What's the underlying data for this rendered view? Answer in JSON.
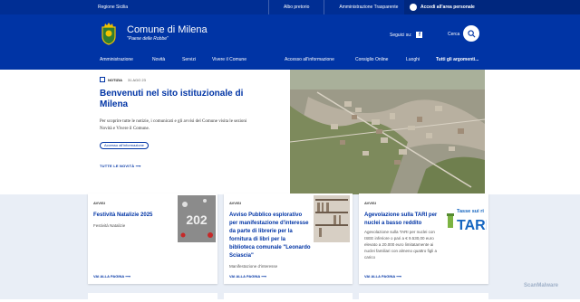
{
  "topbar": {
    "region": "Regione Sicilia",
    "links": [
      "Albo pretorio",
      "Amministrazione Trasparente"
    ],
    "login": "Accedi all'area personale"
  },
  "header": {
    "name": "Comune di Milena",
    "motto": "\"Paese delle Robbe\"",
    "social_label": "Seguici su:",
    "search_label": "Cerca"
  },
  "nav": {
    "left": [
      "Amministrazione",
      "Novità",
      "Servizi",
      "Vivere il Comune"
    ],
    "right": [
      "Accesso all'informazione",
      "Consiglio Online",
      "Luoghi",
      "Tutti gli argomenti..."
    ]
  },
  "hero": {
    "tag": "NOTIZIA",
    "date": "31 AGO 23",
    "title": "Benvenuti nel sito istituzionale di Milena",
    "text": "Per scoprire tutte le notizie, i comunicati e gli avvisi del Comune visita le sezioni Novità e Vivere il Comune.",
    "pill": "Accesso all'informazione",
    "all_news": "TUTTE LE NOVITÀ"
  },
  "cards": [
    {
      "kind": "AVVISI",
      "title": "Festività Natalizie 2025",
      "sub": "Festività Natalizie",
      "more": "VAI ALLA PAGINA",
      "thumb_text": "202"
    },
    {
      "kind": "AVVISI",
      "title": "Avviso Pubblico esplorativo per manifestazione d'interesse da parte di librerie per la fornitura di libri per la biblioteca comunale \"Leonardo Sciascia\"",
      "sub": "Manifestazione d'interesse",
      "more": "VAI ALLA PAGINA"
    },
    {
      "kind": "AVVISI",
      "title": "Agevolazione sulla TARI per nuclei a basso reddito",
      "sub": "Agevolazione sulla TARI per nuclei con ISEE inferiore o pari a € 9.530,00 euro elevato a 20.000 euro limitatamente ai nuclei familiari con almeno quattro figli a carico",
      "more": "VAI ALLA PAGINA",
      "thumb_text": "Tasse sui ri",
      "thumb_big": "TARI"
    }
  ],
  "watermark": "ScanMalware",
  "colors": {
    "brand": "#0034a5",
    "topbar": "#002e94",
    "bg_lower": "#e9eef6"
  }
}
